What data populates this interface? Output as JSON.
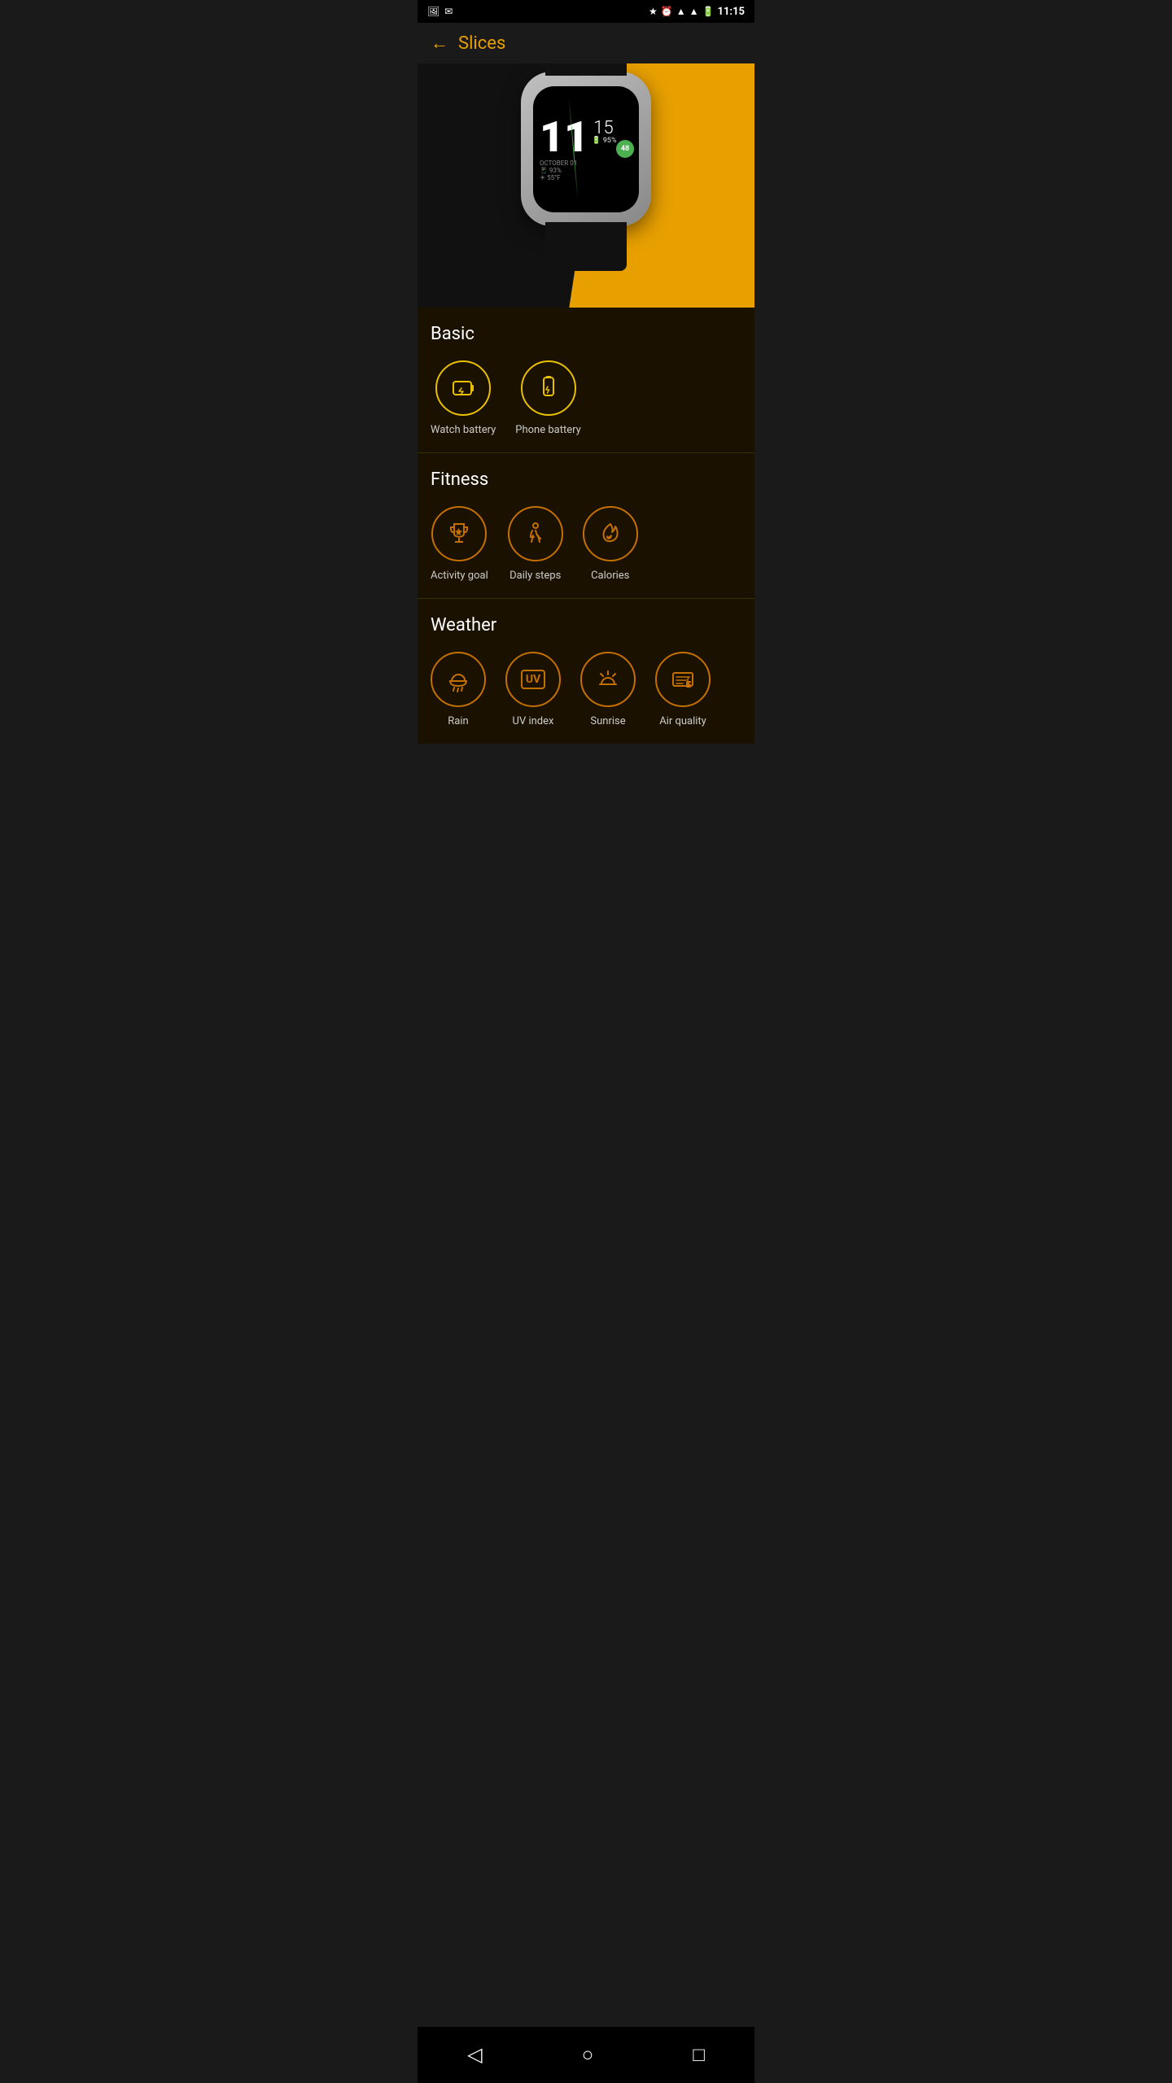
{
  "statusBar": {
    "time": "11:15",
    "icons": [
      "photo",
      "mail",
      "bluetooth",
      "alarm",
      "wifi",
      "signal",
      "battery"
    ]
  },
  "header": {
    "backLabel": "←",
    "title": "Slices"
  },
  "watch": {
    "hour": "11",
    "minute": "15",
    "batteryIcon": "🔋",
    "batteryPct": "95%",
    "date": "OCTOBER 01",
    "phonePct": "93%",
    "weatherIcon": "☀",
    "temp": "55°F",
    "stepsBadge": "48"
  },
  "sections": [
    {
      "id": "basic",
      "title": "Basic",
      "items": [
        {
          "id": "watch-battery",
          "label": "Watch battery",
          "iconType": "yellow",
          "icon": "battery"
        },
        {
          "id": "phone-battery",
          "label": "Phone battery",
          "iconType": "yellow",
          "icon": "phone-battery"
        }
      ]
    },
    {
      "id": "fitness",
      "title": "Fitness",
      "items": [
        {
          "id": "activity-goal",
          "label": "Activity goal",
          "iconType": "orange",
          "icon": "trophy"
        },
        {
          "id": "daily-steps",
          "label": "Daily steps",
          "iconType": "orange",
          "icon": "walk"
        },
        {
          "id": "calories",
          "label": "Calories",
          "iconType": "orange",
          "icon": "fire"
        }
      ]
    },
    {
      "id": "weather",
      "title": "Weather",
      "items": [
        {
          "id": "rain",
          "label": "Rain",
          "iconType": "orange",
          "icon": "rain"
        },
        {
          "id": "uv",
          "label": "UV index",
          "iconType": "orange",
          "icon": "uv"
        },
        {
          "id": "sunrise",
          "label": "Sunrise",
          "iconType": "orange",
          "icon": "sunrise"
        },
        {
          "id": "aqi",
          "label": "Air quality",
          "iconType": "orange",
          "icon": "aqi"
        }
      ]
    }
  ],
  "bottomNav": {
    "back": "◁",
    "home": "○",
    "recent": "□"
  }
}
